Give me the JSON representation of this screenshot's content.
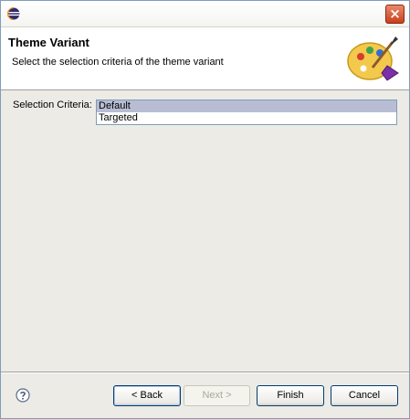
{
  "dialog": {
    "icons": {
      "app": "eclipse-icon",
      "close": "close-icon",
      "banner": "palette-icon",
      "help": "help-icon"
    },
    "close_glyph": "×"
  },
  "banner": {
    "title": "Theme Variant",
    "description": "Select the selection criteria of the theme variant"
  },
  "form": {
    "label": "Selection Criteria:",
    "options": [
      "Default",
      "Targeted"
    ],
    "selected": "Default"
  },
  "buttons": {
    "back": "< Back",
    "next": "Next >",
    "finish": "Finish",
    "cancel": "Cancel"
  }
}
